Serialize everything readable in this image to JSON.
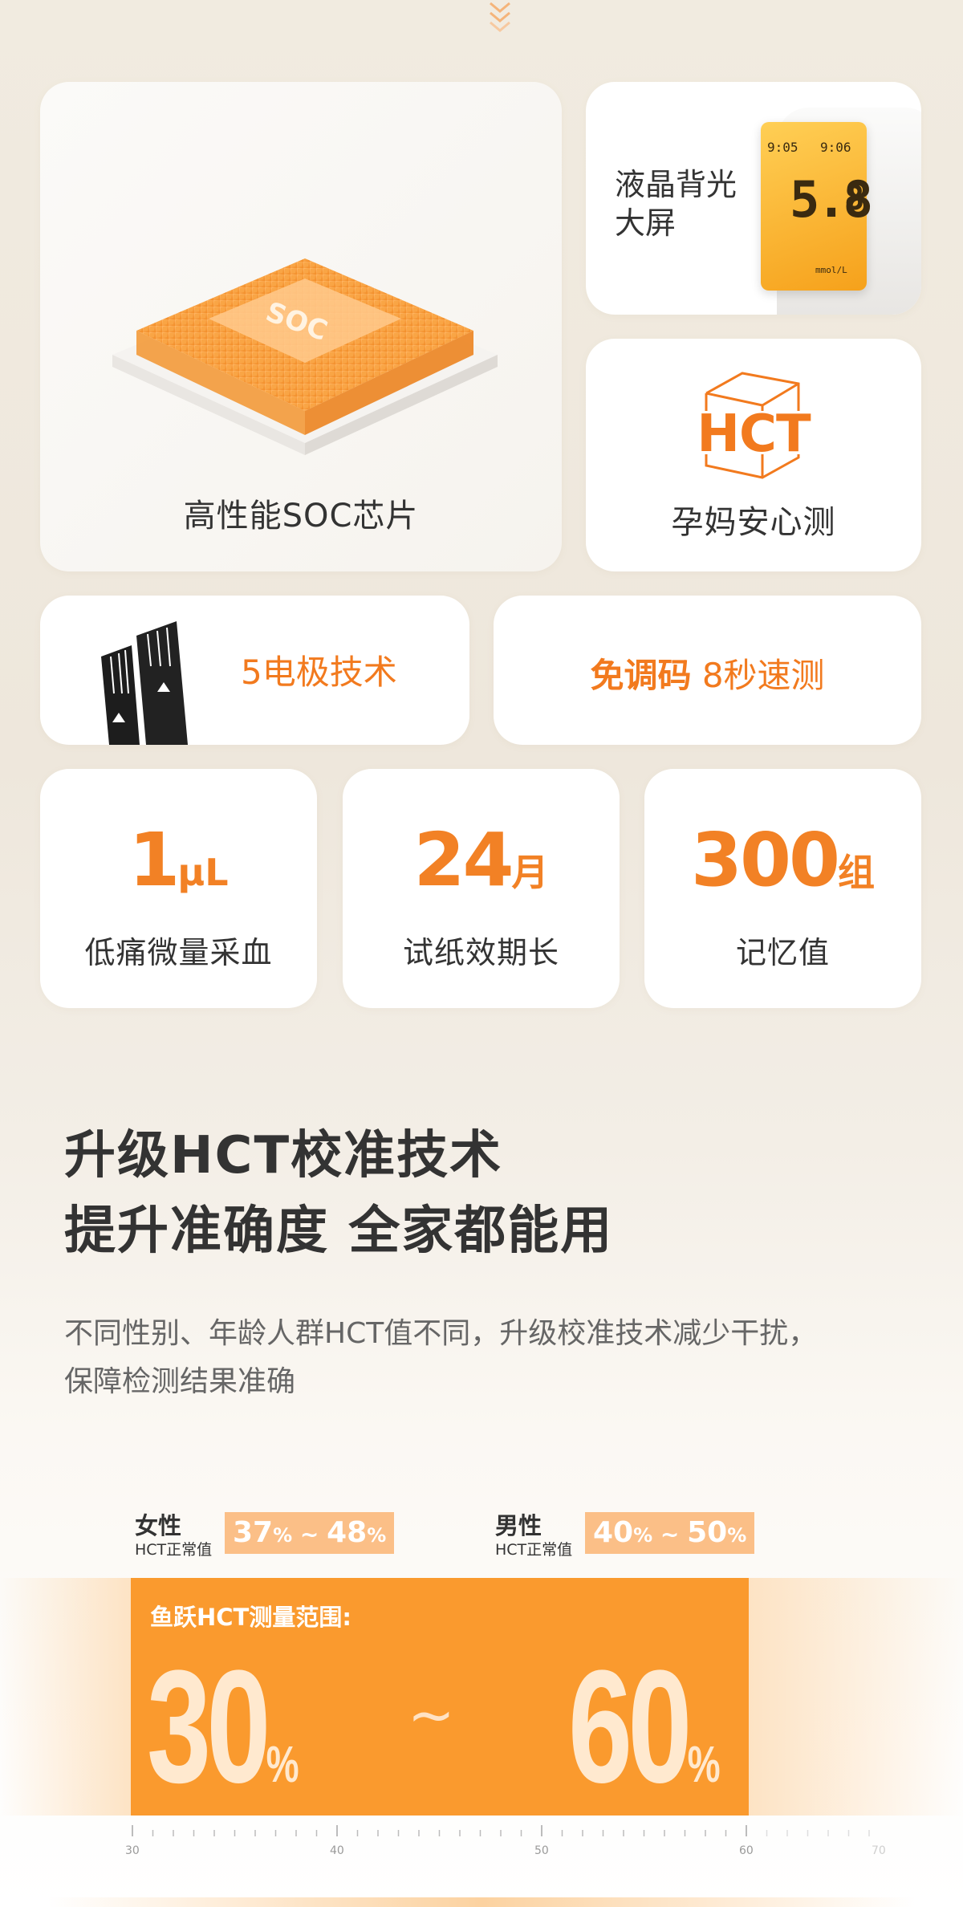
{
  "cards": {
    "soc": {
      "label": "高性能SOC芯片",
      "chip_text": "SOC"
    },
    "lcd": {
      "label_line1": "液晶背光",
      "label_line2": "大屏",
      "display_time_1": "9:05",
      "display_time_2": "9:06",
      "display_value": "5.8",
      "display_value_2": "8",
      "display_unit": "mmol/L"
    },
    "hct": {
      "logo_text": "HCT",
      "label": "孕妈安心测"
    },
    "electrode": {
      "label": "5电极技术"
    },
    "nocode": {
      "bold_part": "免调码",
      "normal_part": "8秒速测"
    },
    "stats": [
      {
        "value": "1",
        "unit": "μL",
        "label": "低痛微量采血"
      },
      {
        "value": "24",
        "unit": "月",
        "label": "试纸效期长"
      },
      {
        "value": "300",
        "unit": "组",
        "label": "记忆值"
      }
    ]
  },
  "headline": {
    "line1": "升级HCT校准技术",
    "line2": "提升准确度 全家都能用"
  },
  "description": {
    "line1": "不同性别、年龄人群HCT值不同，升级校准技术减少干扰，",
    "line2": "保障检测结果准确"
  },
  "hct_norms": {
    "female": {
      "gender": "女性",
      "normal_label": "HCT正常值",
      "range_low": "37",
      "range_high": "48",
      "pct": "%",
      "sep": " ~ "
    },
    "male": {
      "gender": "男性",
      "normal_label": "HCT正常值",
      "range_low": "40",
      "range_high": "50",
      "pct": "%",
      "sep": " ~ "
    }
  },
  "measure": {
    "label": "鱼跃HCT测量范围:",
    "low": "30",
    "high": "60",
    "pct": "%",
    "tilde": "~"
  },
  "ruler": {
    "ticks": [
      "30",
      "40",
      "50",
      "60",
      "70"
    ]
  },
  "colors": {
    "accent": "#f28125",
    "bar": "#fa9a2e",
    "range_bg": "#fbbf87"
  }
}
